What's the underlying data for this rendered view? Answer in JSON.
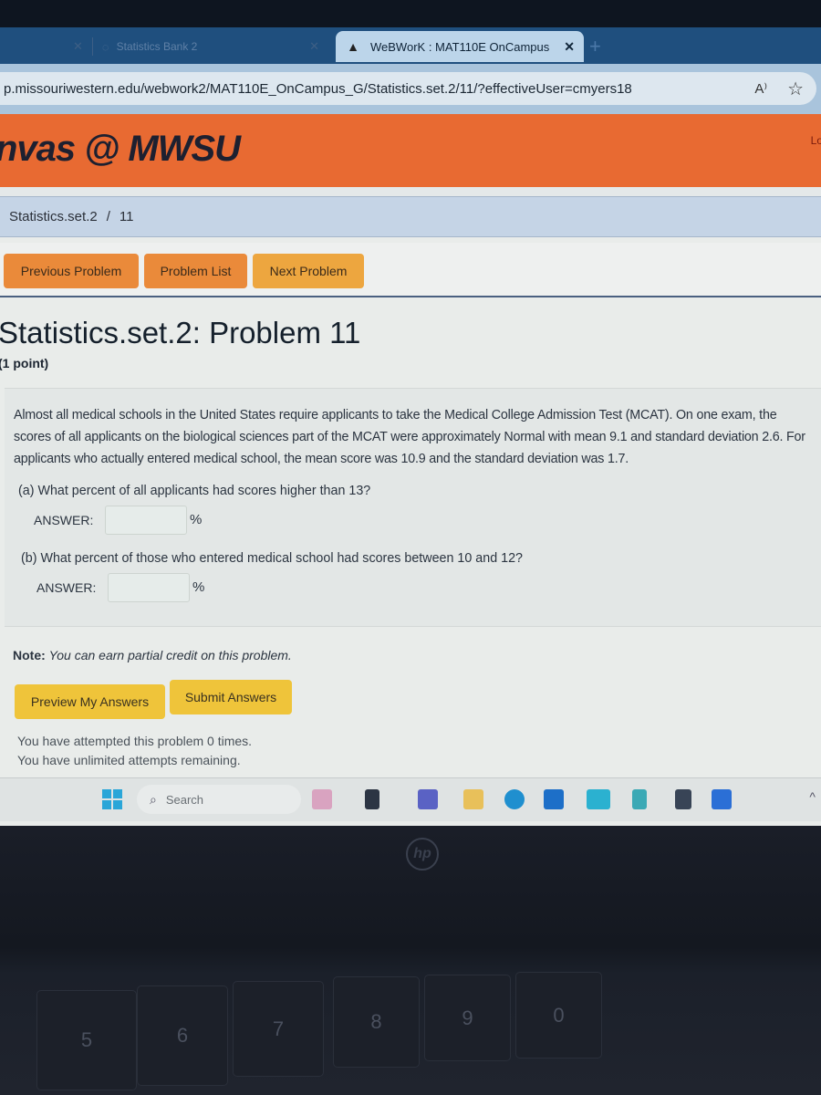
{
  "browser": {
    "tabs": [
      {
        "label": "Statistics Bank 2",
        "active": false
      },
      {
        "label": "WeBWorK : MAT110E OnCampus",
        "active": true
      }
    ],
    "url": "p.missouriwestern.edu/webwork2/MAT110E_OnCampus_G/Statistics.set.2/11/?effectiveUser=cmyers18",
    "read_aloud_label": "A⁾",
    "new_tab_glyph": "+"
  },
  "site": {
    "brand": "nvas @ MWSU",
    "login_link": "Lo",
    "header_color": "#e86a32"
  },
  "breadcrumb": {
    "set": "Statistics.set.2",
    "separator": "/",
    "problem": "11"
  },
  "nav": {
    "previous": "Previous Problem",
    "list": "Problem List",
    "next": "Next Problem"
  },
  "problem": {
    "title": "Statistics.set.2: Problem 11",
    "points": "(1 point)",
    "statement": "Almost all medical schools in the United States require applicants to take the Medical College Admission Test (MCAT). On one exam, the scores of all applicants on the biological sciences part of the MCAT were approximately Normal with mean 9.1 and standard deviation 2.6. For applicants who actually entered medical school, the mean score was 10.9 and the standard deviation was 1.7.",
    "parts": [
      {
        "question": "(a) What percent of all applicants had scores higher than 13?",
        "answer_label": "ANSWER:",
        "value": "",
        "unit": "%"
      },
      {
        "question": "(b) What percent of those who entered medical school had scores between 10 and 12?",
        "answer_label": "ANSWER:",
        "value": "",
        "unit": "%"
      }
    ],
    "note_label": "Note:",
    "note_text": "You can earn partial credit on this problem."
  },
  "actions": {
    "preview": "Preview My Answers",
    "submit": "Submit Answers"
  },
  "attempts": {
    "line1": "You have attempted this problem 0 times.",
    "line2": "You have unlimited attempts remaining."
  },
  "taskbar": {
    "search_placeholder": "Search",
    "apps": [
      "widgets-app",
      "file-explorer-app",
      "teams-app",
      "folder-app",
      "edge-app",
      "store-app",
      "mcafee-app",
      "notepad-app",
      "sticky-notes-app",
      "word-app"
    ]
  },
  "laptop": {
    "logo": "hp",
    "keys": [
      "5",
      "6",
      "7",
      "8",
      "9",
      "0"
    ]
  }
}
